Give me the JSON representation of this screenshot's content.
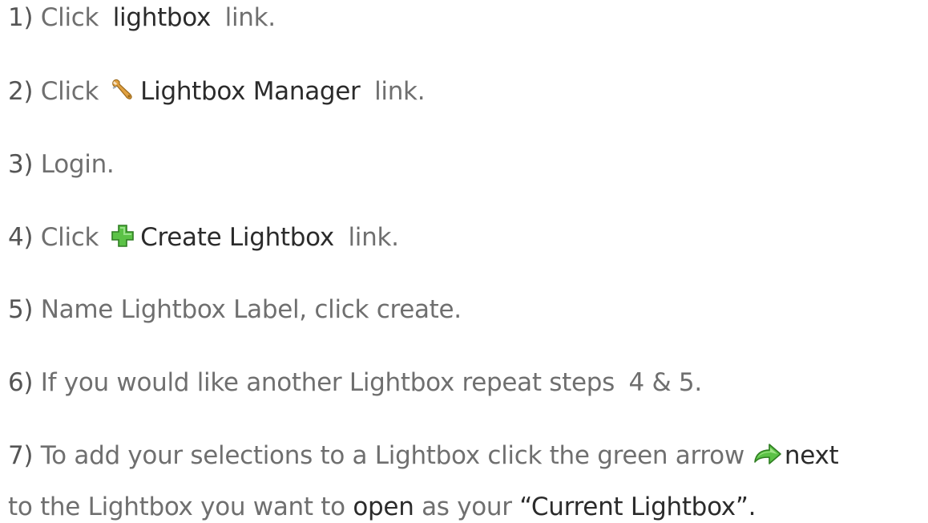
{
  "steps": {
    "s1": {
      "num": "1)",
      "pre": "Click",
      "link": "lightbox",
      "post": "link."
    },
    "s2": {
      "num": "2)",
      "pre": "Click",
      "icon": "wrench-icon",
      "link": "Lightbox Manager",
      "post": "link."
    },
    "s3": {
      "num": "3)",
      "text": "Login."
    },
    "s4": {
      "num": "4)",
      "pre": "Click",
      "icon": "green-plus-icon",
      "link": "Create Lightbox",
      "post": "link."
    },
    "s5": {
      "num": "5)",
      "text": "Name Lightbox Label, click create."
    },
    "s6": {
      "num": "6)",
      "text": "If you would like another Lightbox repeat steps",
      "steps_ref": "4 & 5."
    },
    "s7": {
      "num": "7)",
      "text": "To add your selections to a Lightbox click the green arrow",
      "icon": "green-arrow-icon",
      "after_icon": "next",
      "line2_pre": "to the Lightbox you want to",
      "line2_open": "open",
      "line2_mid": "as your",
      "line2_quote": "“Current Lightbox”."
    }
  },
  "colors": {
    "text_gray": "#6f6f6f",
    "text_dark": "#2b2b2b",
    "icon_green": "#4caf3a",
    "icon_wrench": "#e0a040"
  }
}
